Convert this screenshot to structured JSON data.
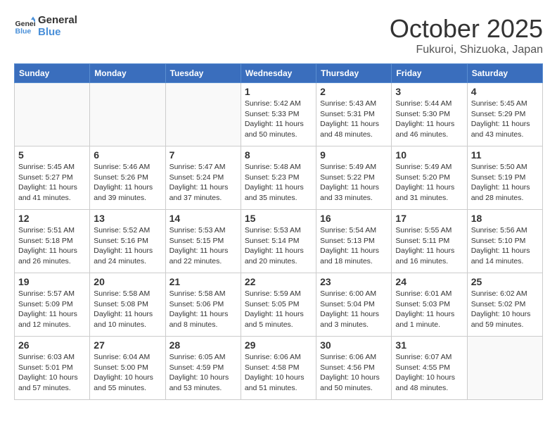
{
  "header": {
    "logo_general": "General",
    "logo_blue": "Blue",
    "month": "October 2025",
    "location": "Fukuroi, Shizuoka, Japan"
  },
  "weekdays": [
    "Sunday",
    "Monday",
    "Tuesday",
    "Wednesday",
    "Thursday",
    "Friday",
    "Saturday"
  ],
  "weeks": [
    [
      {
        "day": "",
        "info": ""
      },
      {
        "day": "",
        "info": ""
      },
      {
        "day": "",
        "info": ""
      },
      {
        "day": "1",
        "info": "Sunrise: 5:42 AM\nSunset: 5:33 PM\nDaylight: 11 hours\nand 50 minutes."
      },
      {
        "day": "2",
        "info": "Sunrise: 5:43 AM\nSunset: 5:31 PM\nDaylight: 11 hours\nand 48 minutes."
      },
      {
        "day": "3",
        "info": "Sunrise: 5:44 AM\nSunset: 5:30 PM\nDaylight: 11 hours\nand 46 minutes."
      },
      {
        "day": "4",
        "info": "Sunrise: 5:45 AM\nSunset: 5:29 PM\nDaylight: 11 hours\nand 43 minutes."
      }
    ],
    [
      {
        "day": "5",
        "info": "Sunrise: 5:45 AM\nSunset: 5:27 PM\nDaylight: 11 hours\nand 41 minutes."
      },
      {
        "day": "6",
        "info": "Sunrise: 5:46 AM\nSunset: 5:26 PM\nDaylight: 11 hours\nand 39 minutes."
      },
      {
        "day": "7",
        "info": "Sunrise: 5:47 AM\nSunset: 5:24 PM\nDaylight: 11 hours\nand 37 minutes."
      },
      {
        "day": "8",
        "info": "Sunrise: 5:48 AM\nSunset: 5:23 PM\nDaylight: 11 hours\nand 35 minutes."
      },
      {
        "day": "9",
        "info": "Sunrise: 5:49 AM\nSunset: 5:22 PM\nDaylight: 11 hours\nand 33 minutes."
      },
      {
        "day": "10",
        "info": "Sunrise: 5:49 AM\nSunset: 5:20 PM\nDaylight: 11 hours\nand 31 minutes."
      },
      {
        "day": "11",
        "info": "Sunrise: 5:50 AM\nSunset: 5:19 PM\nDaylight: 11 hours\nand 28 minutes."
      }
    ],
    [
      {
        "day": "12",
        "info": "Sunrise: 5:51 AM\nSunset: 5:18 PM\nDaylight: 11 hours\nand 26 minutes."
      },
      {
        "day": "13",
        "info": "Sunrise: 5:52 AM\nSunset: 5:16 PM\nDaylight: 11 hours\nand 24 minutes."
      },
      {
        "day": "14",
        "info": "Sunrise: 5:53 AM\nSunset: 5:15 PM\nDaylight: 11 hours\nand 22 minutes."
      },
      {
        "day": "15",
        "info": "Sunrise: 5:53 AM\nSunset: 5:14 PM\nDaylight: 11 hours\nand 20 minutes."
      },
      {
        "day": "16",
        "info": "Sunrise: 5:54 AM\nSunset: 5:13 PM\nDaylight: 11 hours\nand 18 minutes."
      },
      {
        "day": "17",
        "info": "Sunrise: 5:55 AM\nSunset: 5:11 PM\nDaylight: 11 hours\nand 16 minutes."
      },
      {
        "day": "18",
        "info": "Sunrise: 5:56 AM\nSunset: 5:10 PM\nDaylight: 11 hours\nand 14 minutes."
      }
    ],
    [
      {
        "day": "19",
        "info": "Sunrise: 5:57 AM\nSunset: 5:09 PM\nDaylight: 11 hours\nand 12 minutes."
      },
      {
        "day": "20",
        "info": "Sunrise: 5:58 AM\nSunset: 5:08 PM\nDaylight: 11 hours\nand 10 minutes."
      },
      {
        "day": "21",
        "info": "Sunrise: 5:58 AM\nSunset: 5:06 PM\nDaylight: 11 hours\nand 8 minutes."
      },
      {
        "day": "22",
        "info": "Sunrise: 5:59 AM\nSunset: 5:05 PM\nDaylight: 11 hours\nand 5 minutes."
      },
      {
        "day": "23",
        "info": "Sunrise: 6:00 AM\nSunset: 5:04 PM\nDaylight: 11 hours\nand 3 minutes."
      },
      {
        "day": "24",
        "info": "Sunrise: 6:01 AM\nSunset: 5:03 PM\nDaylight: 11 hours\nand 1 minute."
      },
      {
        "day": "25",
        "info": "Sunrise: 6:02 AM\nSunset: 5:02 PM\nDaylight: 10 hours\nand 59 minutes."
      }
    ],
    [
      {
        "day": "26",
        "info": "Sunrise: 6:03 AM\nSunset: 5:01 PM\nDaylight: 10 hours\nand 57 minutes."
      },
      {
        "day": "27",
        "info": "Sunrise: 6:04 AM\nSunset: 5:00 PM\nDaylight: 10 hours\nand 55 minutes."
      },
      {
        "day": "28",
        "info": "Sunrise: 6:05 AM\nSunset: 4:59 PM\nDaylight: 10 hours\nand 53 minutes."
      },
      {
        "day": "29",
        "info": "Sunrise: 6:06 AM\nSunset: 4:58 PM\nDaylight: 10 hours\nand 51 minutes."
      },
      {
        "day": "30",
        "info": "Sunrise: 6:06 AM\nSunset: 4:56 PM\nDaylight: 10 hours\nand 50 minutes."
      },
      {
        "day": "31",
        "info": "Sunrise: 6:07 AM\nSunset: 4:55 PM\nDaylight: 10 hours\nand 48 minutes."
      },
      {
        "day": "",
        "info": ""
      }
    ]
  ]
}
